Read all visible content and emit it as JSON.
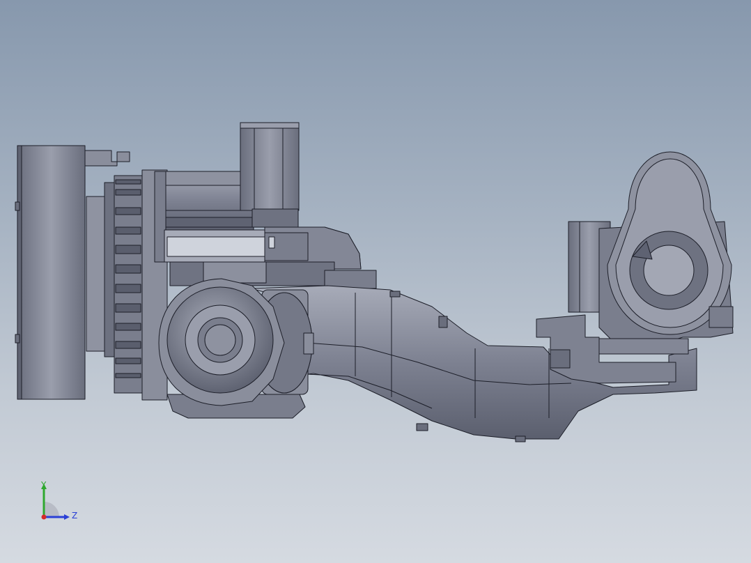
{
  "viewport": {
    "background_top": "#8798ad",
    "background_bottom": "#d5dae1"
  },
  "model": {
    "part_fill": "#7d8191",
    "part_fill_light": "#9a9eac",
    "part_fill_dark": "#5e6272",
    "edge_color": "#1c1e28"
  },
  "triad": {
    "y_label": "Y",
    "z_label": "Z",
    "y_color": "#2fa82f",
    "z_color": "#2a3fd6",
    "x_color": "#d42a2a"
  }
}
